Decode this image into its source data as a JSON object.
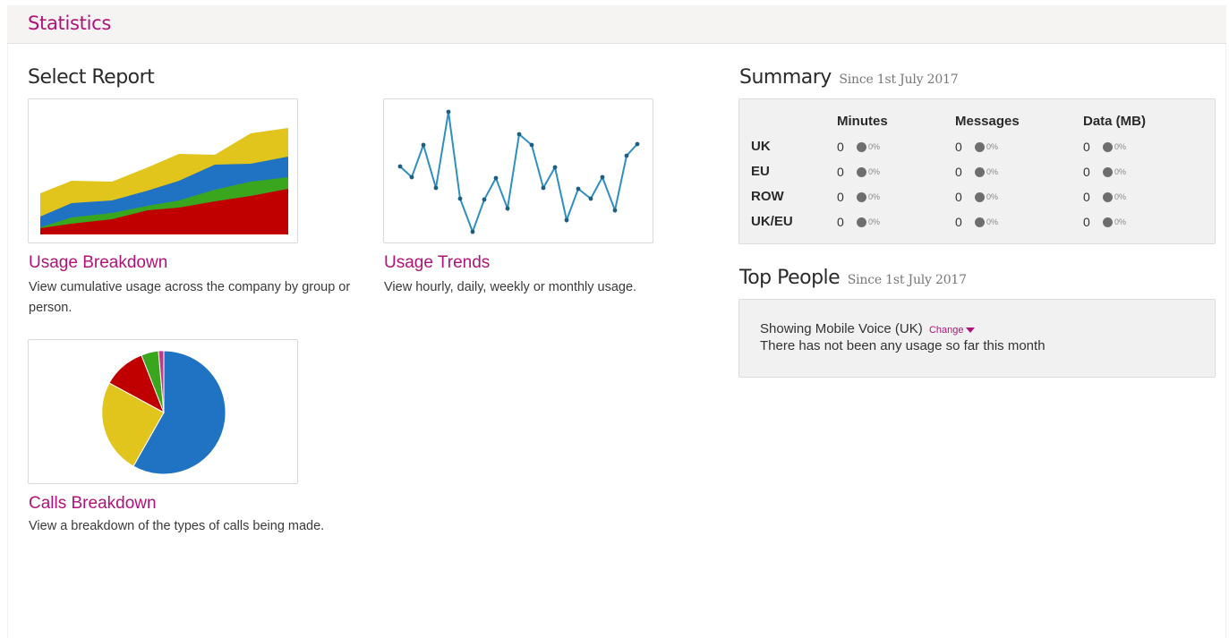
{
  "header": {
    "title": "Statistics"
  },
  "select_report": {
    "heading": "Select Report",
    "reports": [
      {
        "title": "Usage Breakdown",
        "description": "View cumulative usage across the company by group or person."
      },
      {
        "title": "Usage Trends",
        "description": "View hourly, daily, weekly or monthly usage."
      },
      {
        "title": "Calls Breakdown",
        "description": "View a breakdown of the types of calls being made."
      }
    ]
  },
  "colors": {
    "accent": "#b1127a",
    "red": "#c00000",
    "green": "#3aa61e",
    "blue": "#1f73c2",
    "yellow": "#e2c51c",
    "line": "#2e8fc0"
  },
  "summary": {
    "heading": "Summary",
    "since": "Since 1st July 2017",
    "columns": [
      "Minutes",
      "Messages",
      "Data (MB)"
    ],
    "rows": [
      {
        "label": "UK",
        "cells": [
          {
            "value": "0",
            "pct": "0%"
          },
          {
            "value": "0",
            "pct": "0%"
          },
          {
            "value": "0",
            "pct": "0%"
          }
        ]
      },
      {
        "label": "EU",
        "cells": [
          {
            "value": "0",
            "pct": "0%"
          },
          {
            "value": "0",
            "pct": "0%"
          },
          {
            "value": "0",
            "pct": "0%"
          }
        ]
      },
      {
        "label": "ROW",
        "cells": [
          {
            "value": "0",
            "pct": "0%"
          },
          {
            "value": "0",
            "pct": "0%"
          },
          {
            "value": "0",
            "pct": "0%"
          }
        ]
      },
      {
        "label": "UK/EU",
        "cells": [
          {
            "value": "0",
            "pct": "0%"
          },
          {
            "value": "0",
            "pct": "0%"
          },
          {
            "value": "0",
            "pct": "0%"
          }
        ]
      }
    ]
  },
  "top_people": {
    "heading": "Top People",
    "since": "Since 1st July 2017",
    "showing": "Showing Mobile Voice (UK)",
    "change_label": "Change",
    "message": "There has not been any usage so far this month"
  }
}
